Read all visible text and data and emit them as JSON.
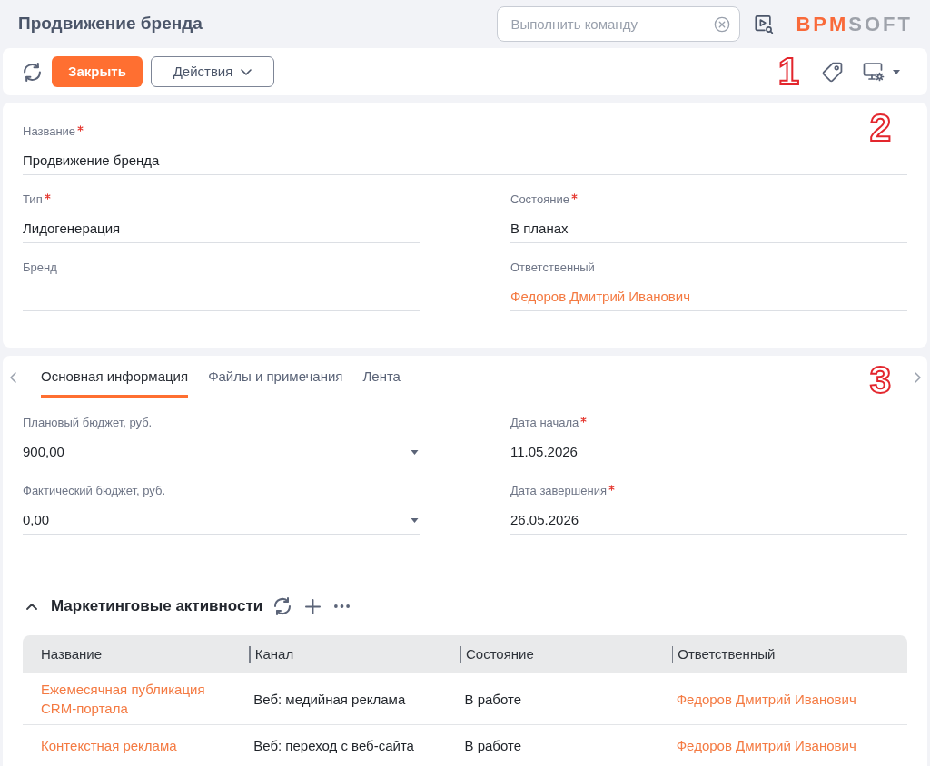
{
  "header": {
    "title": "Продвижение бренда",
    "command_field": {
      "placeholder": "Выполнить команду"
    },
    "logo": {
      "accent": "BPM",
      "rest": "SOFT"
    }
  },
  "toolbar": {
    "buttons": [
      {
        "label": "Закрыть",
        "kind": "primary"
      },
      {
        "label": "Действия",
        "kind": "menu"
      }
    ],
    "callout": "1"
  },
  "main_card": {
    "callout": "2",
    "rows": [
      {
        "fields": [
          {
            "label": "Название",
            "required": true,
            "kind": "text",
            "value": "Продвижение бренда"
          }
        ]
      },
      {
        "fields": [
          {
            "label": "Тип",
            "required": true,
            "kind": "text",
            "value": "Лидогенерация"
          },
          {
            "label": "Состояние",
            "required": true,
            "kind": "text",
            "value": "В планах"
          }
        ]
      },
      {
        "fields": [
          {
            "label": "Бренд",
            "required": false,
            "kind": "text"
          },
          {
            "label": "Ответственный",
            "required": false,
            "kind": "link",
            "value": "Федоров Дмитрий Иванович"
          }
        ]
      }
    ]
  },
  "details": {
    "callout": "3",
    "tabs": [
      {
        "label": "Основная информация",
        "selected": true
      },
      {
        "label": "Файлы и примечания",
        "selected": false
      },
      {
        "label": "Лента",
        "selected": false
      }
    ],
    "rows": [
      {
        "fields": [
          {
            "label": "Плановый бюджет, руб.",
            "required": false,
            "kind": "dropdown",
            "value": "900,00"
          },
          {
            "label": "Дата начала",
            "required": true,
            "kind": "text",
            "value": "11.05.2026"
          }
        ]
      },
      {
        "fields": [
          {
            "label": "Фактический бюджет, руб.",
            "required": false,
            "kind": "dropdown",
            "value": "0,00"
          },
          {
            "label": "Дата завершения",
            "required": true,
            "kind": "text",
            "value": "26.05.2026"
          }
        ]
      }
    ],
    "section": {
      "title": "Маркетинговые активности",
      "expanded": true,
      "table": {
        "columns": [
          {
            "label": "Название",
            "kind": "link"
          },
          {
            "label": "Канал",
            "kind": "text"
          },
          {
            "label": "Состояние",
            "kind": "text"
          },
          {
            "label": "Ответственный",
            "kind": "link"
          }
        ],
        "rows": [
          {
            "cells": [
              "Ежемесячная публикация CRM-портала",
              "Веб: медийная реклама",
              "В работе",
              "Федоров Дмитрий Иванович"
            ]
          },
          {
            "cells": [
              "Контекстная реклама",
              "Веб: переход с веб-сайта",
              "В работе",
              "Федоров Дмитрий Иванович"
            ]
          }
        ]
      }
    }
  }
}
